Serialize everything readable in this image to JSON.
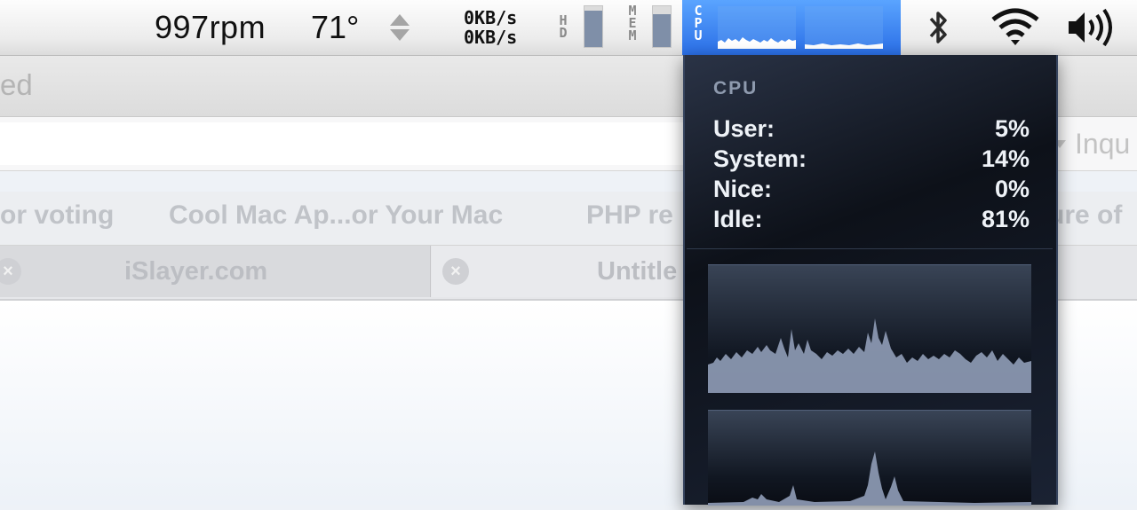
{
  "menubar": {
    "fan_speed": "997rpm",
    "temperature": "71°",
    "network": {
      "upload": "0KB/s",
      "download": "0KB/s"
    },
    "disk": {
      "label_chars": [
        "H",
        "D"
      ],
      "usage_fraction": 0.9
    },
    "memory": {
      "label_chars": [
        "M",
        "E",
        "M"
      ],
      "usage_fraction": 0.8
    },
    "cpu": {
      "label_chars": [
        "C",
        "P",
        "U"
      ]
    },
    "icons": [
      "bluetooth-icon",
      "wifi-icon",
      "volume-icon"
    ]
  },
  "window": {
    "title": "ed",
    "search_placeholder": "Inqu",
    "bookmarks": [
      "or voting",
      "Cool Mac Ap...or Your Mac",
      "PHP re",
      "ure of"
    ],
    "tabs": [
      {
        "title": "iSlayer.com",
        "active": true
      },
      {
        "title": "Untitle",
        "active": false
      }
    ]
  },
  "cpu_panel": {
    "title": "CPU",
    "stats": [
      {
        "label": "User:",
        "value": "5%"
      },
      {
        "label": "System:",
        "value": "14%"
      },
      {
        "label": "Nice:",
        "value": "0%"
      },
      {
        "label": "Idle:",
        "value": "81%"
      }
    ]
  },
  "colors": {
    "menu_highlight": "#3b86f5",
    "graph_fill": "#8a97b0",
    "panel_bg": "#0d1119",
    "panel_text": "#eef2f7"
  }
}
